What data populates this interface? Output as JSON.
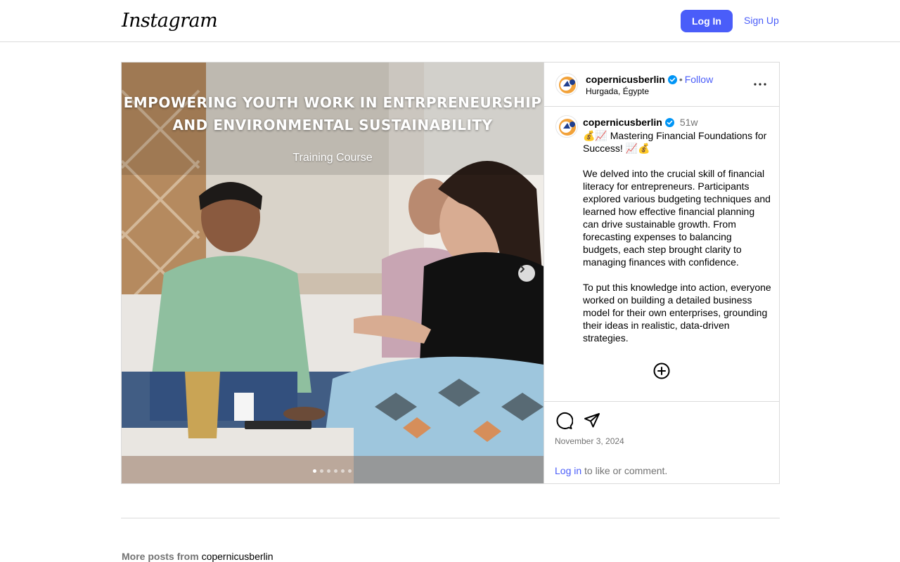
{
  "header": {
    "logo": "Instagram",
    "login_label": "Log In",
    "signup_label": "Sign Up"
  },
  "post": {
    "media": {
      "overlay_title_line1": "EMPOWERING YOUTH WORK IN ENTRPRENEURSHIP",
      "overlay_title_line2": "AND ENVIRONMENTAL SUSTAINABILITY",
      "overlay_subtitle": "Training Course",
      "slide_count": 6,
      "active_slide": 1
    },
    "author": {
      "username": "copernicusberlin",
      "separator": "•",
      "follow_label": "Follow",
      "location": "Hurgada, Égypte"
    },
    "caption": {
      "username": "copernicusberlin",
      "age": "51w",
      "text": "💰📈 Mastering Financial Foundations for Success! 📈💰\n\nWe delved into the crucial skill of financial literacy for entrepreneurs. Participants explored various budgeting techniques and learned how effective financial planning can drive sustainable growth. From forecasting expenses to balancing budgets, each step brought clarity to managing finances with confidence.\n\nTo put this knowledge into action, everyone worked on building a detailed business model for their own enterprises, grounding their ideas in realistic, data-driven strategies."
    },
    "date": "November 3, 2024",
    "login_prompt": {
      "link": "Log in",
      "rest": " to like or comment."
    }
  },
  "more_posts": {
    "label": "More posts from ",
    "username": "copernicusberlin"
  },
  "colors": {
    "accent": "#4a5df9",
    "border": "#dbdbdb",
    "muted": "#737373",
    "verified": "#0095f6"
  },
  "icons": [
    "verified-badge-icon",
    "more-options-icon",
    "chevron-right-icon",
    "add-circle-icon",
    "comment-icon",
    "share-icon"
  ]
}
